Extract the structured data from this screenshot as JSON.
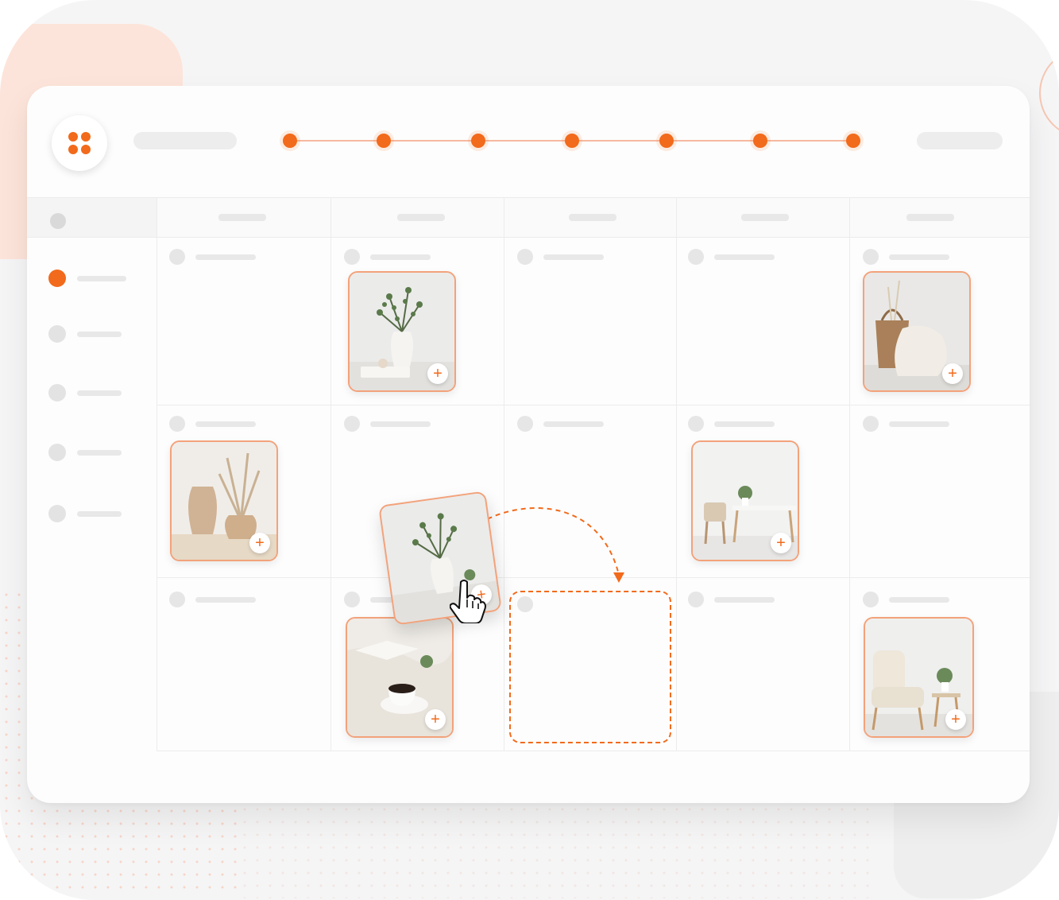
{
  "app": {
    "logo_icon": "grid-dots-icon",
    "accent_color": "#f26a1b",
    "accent_light": "#f3a27a"
  },
  "timeline": {
    "steps": 7
  },
  "calendar": {
    "columns": 5,
    "rows": 3,
    "row_labels": 5,
    "active_row_label": 0,
    "cells_with_images": [
      {
        "row": 0,
        "col": 1,
        "icon": "vase-eucalyptus-image"
      },
      {
        "row": 0,
        "col": 4,
        "icon": "basket-blanket-image"
      },
      {
        "row": 1,
        "col": 0,
        "icon": "pampas-vases-image"
      },
      {
        "row": 1,
        "col": 3,
        "icon": "desk-chair-image"
      },
      {
        "row": 2,
        "col": 1,
        "icon": "coffee-book-image"
      },
      {
        "row": 2,
        "col": 4,
        "icon": "armchair-plant-image"
      }
    ],
    "dragging": {
      "icon": "vase-eucalyptus-image",
      "cursor": "hand-pointer-icon",
      "target": {
        "row": 2,
        "col": 2
      }
    }
  },
  "add_label": "+"
}
